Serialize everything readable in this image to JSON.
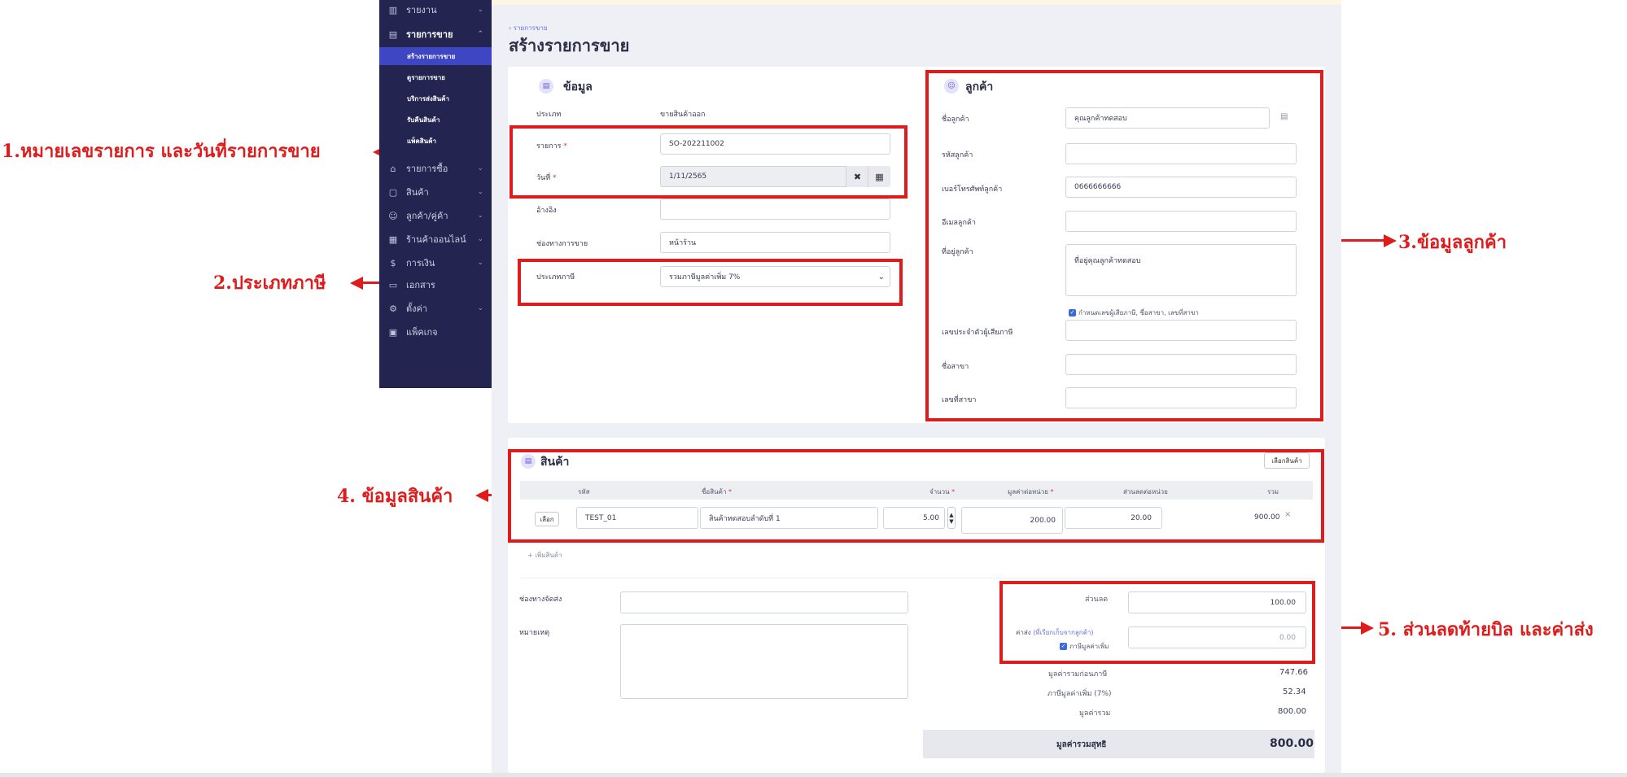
{
  "annotations": {
    "a1": "1.หมายเลขรายการ และวันที่รายการขาย",
    "a2": "2.ประเภทภาษี",
    "a3": "3.ข้อมูลลูกค้า",
    "a4": "4. ข้อมูลสินค้า",
    "a5": "5. ส่วนลดท้ายบิล และค่าส่ง"
  },
  "sidebar": {
    "items": [
      {
        "label": "รายงาน",
        "icon": "chart-icon"
      },
      {
        "label": "รายการขาย",
        "icon": "receipt-icon"
      },
      {
        "label": "รายการซื้อ",
        "icon": "cart-icon"
      },
      {
        "label": "สินค้า",
        "icon": "box-icon"
      },
      {
        "label": "ลูกค้า/คู่ค้า",
        "icon": "users-icon"
      },
      {
        "label": "ร้านค้าออนไลน์",
        "icon": "store-icon"
      },
      {
        "label": "การเงิน",
        "icon": "money-icon"
      },
      {
        "label": "เอกสาร",
        "icon": "doc-icon"
      },
      {
        "label": "ตั้งค่า",
        "icon": "gear-icon"
      },
      {
        "label": "แพ็คเกจ",
        "icon": "package-icon"
      }
    ],
    "sub_items": [
      "สร้างรายการขาย",
      "ดูรายการขาย",
      "บริการส่งสินค้า",
      "รับคืนสินค้า",
      "แพ็คสินค้า"
    ]
  },
  "page": {
    "breadcrumb": "‹ รายการขาย",
    "title": "สร้างรายการขาย"
  },
  "info": {
    "title": "ข้อมูล",
    "type_label": "ประเภท",
    "type_value": "ขายสินค้าออก",
    "order_label": "รายการ",
    "order_value": "SO-202211002",
    "date_label": "วันที่",
    "date_value": "1/11/2565",
    "clear_symbol": "✖",
    "calendar_symbol": "▦",
    "ref_label": "อ้างอิง",
    "ref_value": "",
    "channel_label": "ช่องทางการขาย",
    "channel_value": "หน้าร้าน",
    "tax_label": "ประเภทภาษี",
    "tax_value": "รวมภาษีมูลค่าเพิ่ม 7%"
  },
  "customer": {
    "title": "ลูกค้า",
    "name_label": "ชื่อลูกค้า",
    "name_value": "คุณลูกค้าทดสอบ",
    "code_label": "รหัสลูกค้า",
    "phone_label": "เบอร์โทรศัพท์ลูกค้า",
    "phone_value": "0666666666",
    "email_label": "อีเมลลูกค้า",
    "address_label": "ที่อยู่ลูกค้า",
    "address_value": "ที่อยู่คุณลูกค้าทดสอบ",
    "taxinfo_check": "กำหนดเลขผู้เสียภาษี, ชื่อสาขา, เลขที่สาขา",
    "taxid_label": "เลขประจำตัวผู้เสียภาษี",
    "branch_label": "ชื่อสาขา",
    "branchno_label": "เลขที่สาขา"
  },
  "products": {
    "title": "สินค้า",
    "choose_btn": "เลือกสินค้า",
    "columns": [
      "รหัส",
      "ชื่อสินค้า",
      "จำนวน",
      "มูลค่าต่อหน่วย",
      "ส่วนลดต่อหน่วย",
      "รวม"
    ],
    "row": {
      "select_btn": "เลือก",
      "code": "TEST_01",
      "name": "สินค้าทดสอบลำดับที่ 1",
      "qty": "5.00",
      "price": "200.00",
      "discount": "20.00",
      "total": "900.00"
    },
    "add_link": "+ เพิ่มสินค้า"
  },
  "footer": {
    "shipping_label": "ช่องทางจัดส่ง",
    "note_label": "หมายเหตุ",
    "discount_label": "ส่วนลด",
    "discount_value": "100.00",
    "shipping_fee_label": "ค่าส่ง",
    "shipping_fee_note": "(ที่เรียกเก็บจากลูกค้า)",
    "shipping_fee_value": "0.00",
    "vat_check_label": "ภาษีมูลค่าเพิ่ม",
    "before_tax_label": "มูลค่ารวมก่อนภาษี",
    "before_tax_value": "747.66",
    "vat_label": "ภาษีมูลค่าเพิ่ม (7%)",
    "vat_value": "52.34",
    "total_label": "มูลค่ารวม",
    "total_value": "800.00",
    "net_label": "มูลค่ารวมสุทธิ",
    "net_value": "800.00"
  },
  "colors": {
    "sidebar_bg": "#23244f",
    "sidebar_active": "#3f46c4",
    "annotation_red": "#e01b1b",
    "page_bg": "#eef0f6"
  }
}
